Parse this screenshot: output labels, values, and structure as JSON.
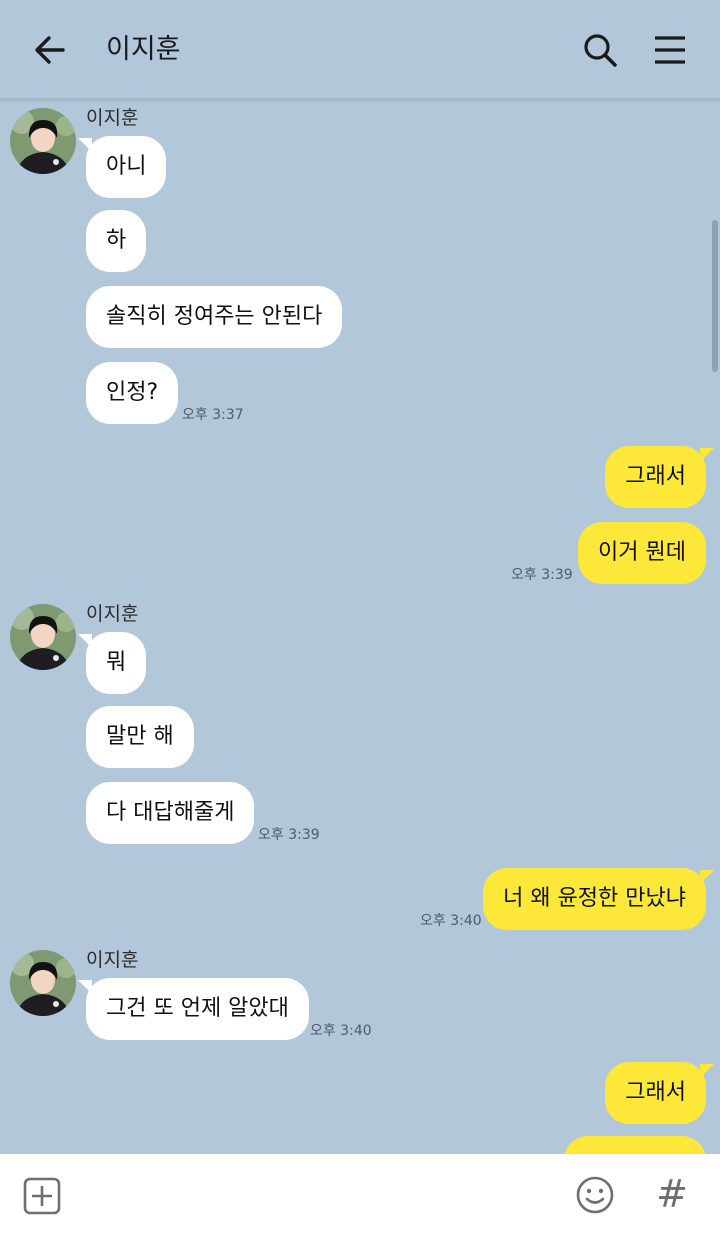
{
  "header": {
    "title": "이지훈",
    "back_icon": "arrow-left-icon",
    "search_icon": "search-icon",
    "menu_icon": "hamburger-menu-icon"
  },
  "messages": [
    {
      "from": "them",
      "sender": "이지훈",
      "text": "아니"
    },
    {
      "from": "them",
      "text": "하"
    },
    {
      "from": "them",
      "text": "솔직히 정여주는 안된다"
    },
    {
      "from": "them",
      "text": "인정?",
      "time": "오후 3:37"
    },
    {
      "from": "me",
      "text": "그래서"
    },
    {
      "from": "me",
      "text": "이거 뭔데",
      "time": "오후 3:39"
    },
    {
      "from": "them",
      "sender": "이지훈",
      "text": "뭐"
    },
    {
      "from": "them",
      "text": "말만 해"
    },
    {
      "from": "them",
      "text": "다 대답해줄게",
      "time": "오후 3:39"
    },
    {
      "from": "me",
      "text": "너 왜 윤정한 만났냐",
      "time": "오후 3:40"
    },
    {
      "from": "them",
      "sender": "이지훈",
      "text": "그건 또 언제 알았대",
      "time": "오후 3:40"
    },
    {
      "from": "me",
      "text": "그래서"
    },
    {
      "from": "me",
      "text": ""
    }
  ],
  "footer": {
    "add_icon": "plus-square-icon",
    "emoji_icon": "emoji-icon",
    "hashtag": "#"
  },
  "colors": {
    "background": "#b2c7da",
    "my_bubble": "#fde83a",
    "their_bubble": "#ffffff"
  }
}
